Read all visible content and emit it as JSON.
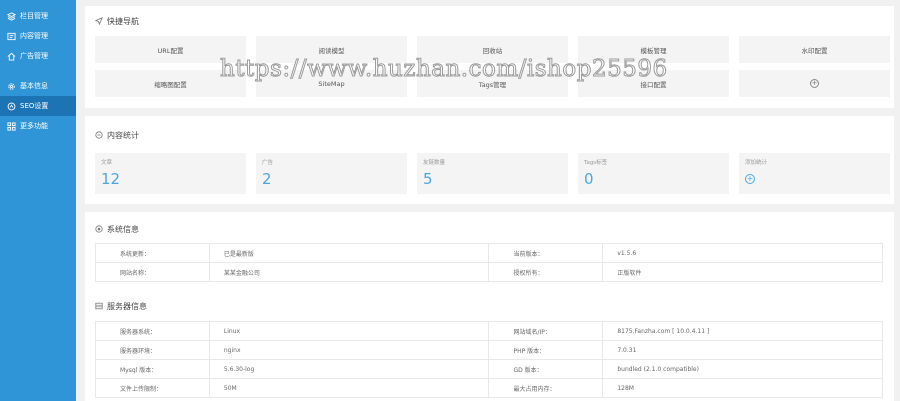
{
  "sidebar": {
    "items": [
      {
        "label": "栏目管理",
        "icon": "layers-icon"
      },
      {
        "label": "内容管理",
        "icon": "content-icon"
      },
      {
        "label": "广告管理",
        "icon": "home-icon"
      },
      {
        "label": "基本信息",
        "icon": "gear-icon"
      },
      {
        "label": "SEO设置",
        "icon": "seo-icon",
        "active": true
      },
      {
        "label": "更多功能",
        "icon": "grid-icon"
      }
    ]
  },
  "quick_nav": {
    "title": "快捷导航",
    "buttons": [
      "URL配置",
      "阅读模型",
      "回收站",
      "模板管理",
      "水印配置",
      "缩略图配置",
      "SiteMap",
      "Tags管理",
      "接口配置"
    ]
  },
  "stats": {
    "title": "内容统计",
    "cards": [
      {
        "label": "文章",
        "value": "12"
      },
      {
        "label": "广告",
        "value": "2"
      },
      {
        "label": "友链数量",
        "value": "5"
      },
      {
        "label": "Tags标签",
        "value": "0"
      }
    ],
    "add_label": "添加统计"
  },
  "system_info": {
    "title": "系统信息",
    "rows": [
      [
        "系统更新：",
        "已是最新版",
        "当前版本：",
        "v1.5.6"
      ],
      [
        "网站名称：",
        "某某金融公司",
        "授权所有：",
        "正版软件"
      ]
    ]
  },
  "server_info": {
    "title": "服务器信息",
    "rows": [
      [
        "服务器系统：",
        "Linux",
        "网站域名/IP：",
        "8175.Fanzha.com [ 10.0.4.11 ]"
      ],
      [
        "服务器环境：",
        "nginx",
        "PHP 版本：",
        "7.0.31"
      ],
      [
        "Mysql 版本：",
        "5.6.30-log",
        "GD 版本：",
        "bundled (2.1.0 compatible)"
      ],
      [
        "文件上传限制：",
        "50M",
        "最大占用内存：",
        "128M"
      ]
    ]
  },
  "watermark": "https://www.huzhan.com/ishop25596"
}
